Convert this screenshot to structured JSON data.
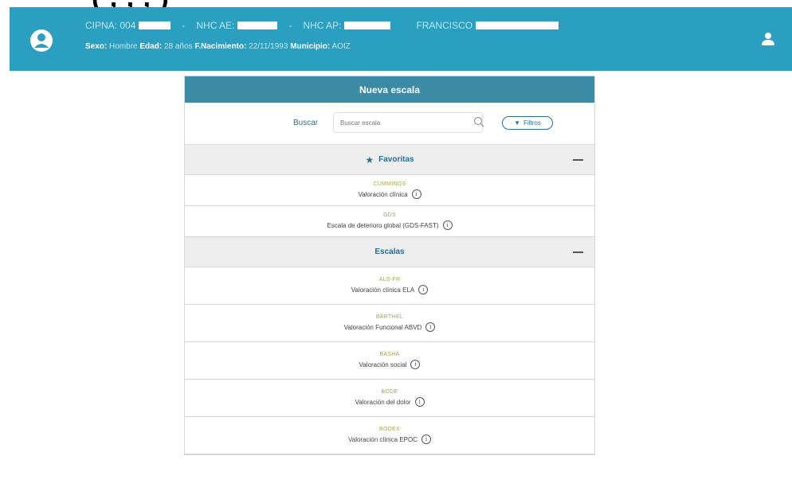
{
  "top_strip_text": "(   ,   ,   ,   )",
  "header": {
    "cipna_label": "CIPNA: 004",
    "nhc_ae_label": "NHC AE:",
    "nhc_ap_label": "NHC AP:",
    "name_label": "FRANCISCO",
    "separator": "-",
    "sexo_label": "Sexo:",
    "sexo_value": "Hombre",
    "edad_label": "Edad:",
    "edad_value": "28 años",
    "nacimiento_label": "F.Nacimiento:",
    "nacimiento_value": "22/11/1993",
    "municipio_label": "Municipio:",
    "municipio_value": "AOIZ"
  },
  "panel": {
    "title": "Nueva escala",
    "search_label": "Buscar",
    "search_placeholder": "Buscar escala",
    "filter_label": "Filtros"
  },
  "favoritas": {
    "label": "Favoritas",
    "items": [
      {
        "code": "CUMMINGS",
        "desc": "Valoración clínica"
      },
      {
        "code": "GDS",
        "desc": "Escala de deterioro global (GDS-FAST)"
      }
    ]
  },
  "escalas": {
    "label": "Escalas",
    "items": [
      {
        "code": "ALS-FR",
        "desc": "Valoración clínica ELA"
      },
      {
        "code": "BARTHEL",
        "desc": "Valoración Funcional ABVD"
      },
      {
        "code": "BASHA",
        "desc": "Valoración social"
      },
      {
        "code": "BODE",
        "desc": "Valoración del dolor"
      },
      {
        "code": "BODEX",
        "desc": "Valoración clínica EPOC"
      }
    ]
  },
  "icons": {
    "avatar": "user-circle-icon",
    "user_menu": "user-icon",
    "search": "magnifier-icon",
    "filter": "funnel-icon",
    "favorite": "star-icon",
    "collapse": "minus-icon",
    "info": "info-icon"
  },
  "colors": {
    "header_bg": "#2a9fc0",
    "panel_title_bg": "#3b8aa6",
    "section_bg": "#eeeeee",
    "code_text": "#a6a84a",
    "accent": "#2a6f94"
  }
}
